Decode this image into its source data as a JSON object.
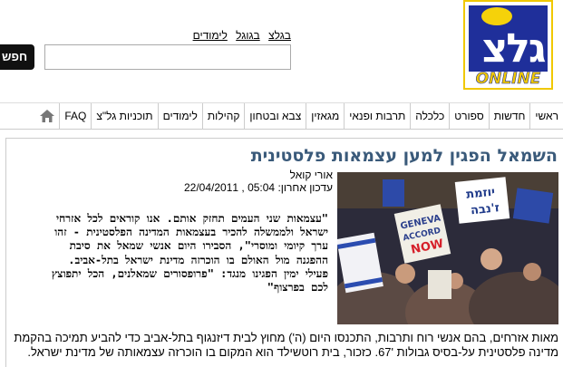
{
  "header": {
    "logo": {
      "letters": "גלצ",
      "sub": "ONLINE",
      "name": "גל\"צ"
    },
    "top_links": [
      "בגלצ",
      "בגוגל",
      "לימודים"
    ],
    "search": {
      "button_label": "חפש",
      "value": ""
    }
  },
  "nav": {
    "items": [
      "ראשי",
      "חדשות",
      "ספורט",
      "כלכלה",
      "תרבות ופנאי",
      "מגאזין",
      "צבא ובטחון",
      "קהילות",
      "לימודים",
      "תוכניות גל\"צ",
      "FAQ"
    ]
  },
  "article": {
    "headline": "השמאל הפגין למען עצמאות פלסטינית",
    "author": "אורי קואל",
    "updated": "עדכון אחרון: 05:04 , 22/04/2011",
    "quote_lines": [
      "\"עצמאות שני העמים תחזק אותם. אנו קוראים לכל אזרחי",
      "ישראל ולממשלה להכיר בעצמאות המדינה הפלסטינית - זהו",
      "ערך קיומי ומוסרי\", הסבירו היום אנשי שמאל את סיבת",
      "ההפגנה מול האולם בו הוכרזה מדינת ישראל בתל-אביב.",
      "פעילי ימין הפגינו מנגד: \"פרופסורים שמאלנים, הכל יתפוצץ",
      "לכם בפרצוף\""
    ],
    "body_lines": [
      "מאות אזרחים, בהם אנשי רוח ותרבות, התכנסו היום (ה') מחוץ לבית דיזנגוף בתל-אביב כדי להביע תמיכה בהקמת",
      "מדינה פלסטינית על-בסיס גבולות '67. כזכור, בית רוטשילד הוא המקום בו הוכרזה עצמאותה של מדינת ישראל."
    ],
    "photo_signs": [
      "GENEVA",
      "ACCORD",
      "NOW",
      "יוזמת",
      "ז'נבה"
    ]
  }
}
